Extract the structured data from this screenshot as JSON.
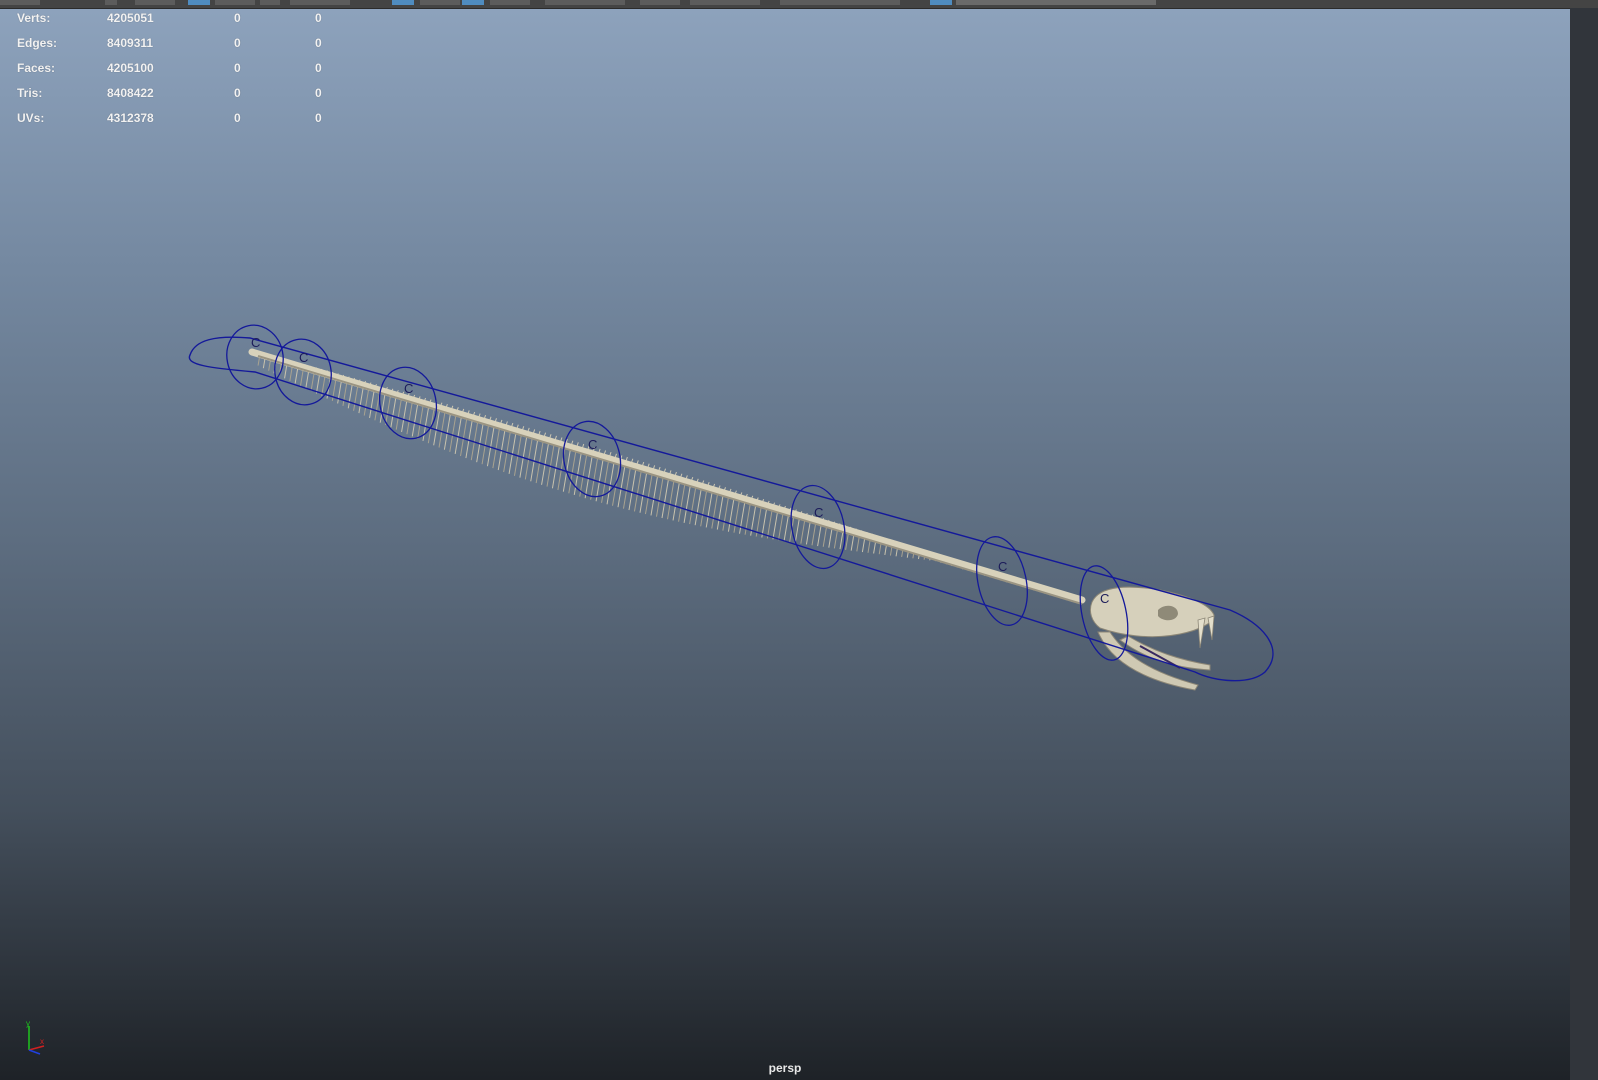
{
  "hud": {
    "rows": [
      {
        "label": "Verts:",
        "total": "4205051",
        "selected": "0",
        "triangles": "0"
      },
      {
        "label": "Edges:",
        "total": "8409311",
        "selected": "0",
        "triangles": "0"
      },
      {
        "label": "Faces:",
        "total": "4205100",
        "selected": "0",
        "triangles": "0"
      },
      {
        "label": "Tris:",
        "total": "8408422",
        "selected": "0",
        "triangles": "0"
      },
      {
        "label": "UVs:",
        "total": "4312378",
        "selected": "0",
        "triangles": "0"
      }
    ]
  },
  "scene": {
    "controls": [
      {
        "label": "C"
      },
      {
        "label": "C"
      },
      {
        "label": "C"
      },
      {
        "label": "C"
      },
      {
        "label": "C"
      },
      {
        "label": "C"
      },
      {
        "label": "C"
      }
    ],
    "control_color": "#14199a",
    "bone_color": "#d8d2bb"
  },
  "axis": {
    "y": "y",
    "x": "x"
  },
  "camera": {
    "name": "persp"
  }
}
